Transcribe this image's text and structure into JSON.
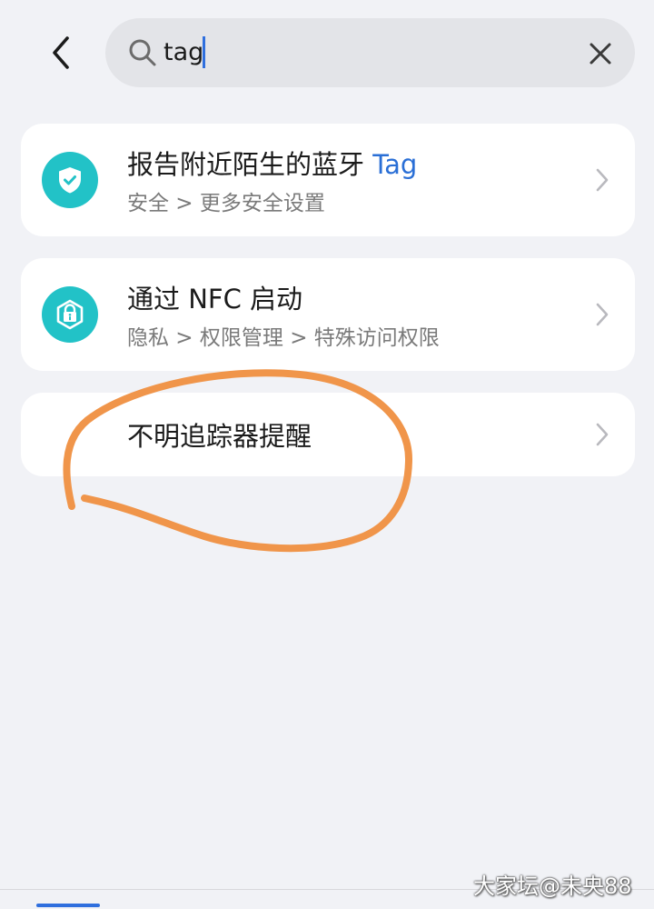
{
  "search": {
    "value": "tag"
  },
  "results": [
    {
      "title_prefix": "报告附近陌生的蓝牙 ",
      "title_highlight": "Tag",
      "subtitle": "安全 > 更多安全设置",
      "icon": "shield-check-icon"
    },
    {
      "title_prefix": "通过 NFC 启动",
      "title_highlight": "",
      "subtitle": "隐私 > 权限管理 > 特殊访问权限",
      "icon": "lock-info-icon"
    },
    {
      "title_prefix": "不明追踪器提醒",
      "title_highlight": "",
      "subtitle": "",
      "icon": ""
    }
  ],
  "watermark": "大家坛@未央88",
  "colors": {
    "accent": "#2a6fd6",
    "icon_bg": "#22c2c7",
    "annotation": "#f0954a",
    "background": "#f1f2f6"
  }
}
